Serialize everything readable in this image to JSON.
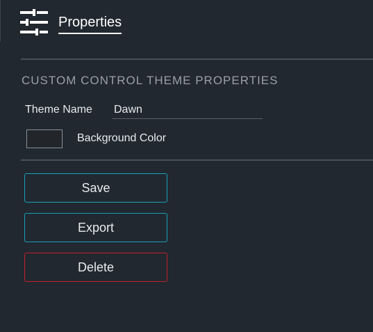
{
  "header": {
    "tab_label": "Properties",
    "icon": "sliders-icon"
  },
  "section": {
    "title": "CUSTOM CONTROL THEME PROPERTIES"
  },
  "theme_name": {
    "label": "Theme Name",
    "value": "Dawn"
  },
  "background_color": {
    "label": "Background Color",
    "swatch_color": "#22262b"
  },
  "buttons": {
    "save": "Save",
    "export": "Export",
    "delete": "Delete"
  },
  "colors": {
    "accent": "#17a2b8",
    "danger": "#c0202c",
    "background": "#222830"
  }
}
